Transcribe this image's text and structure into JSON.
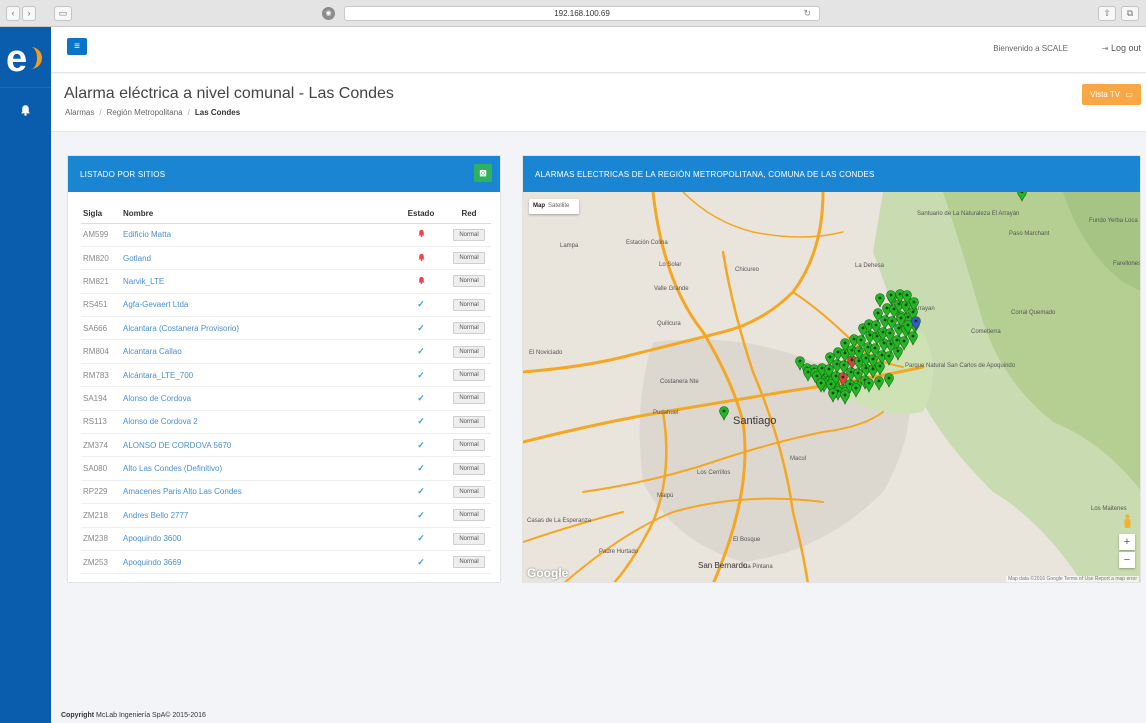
{
  "browser": {
    "url": "192.168.100.69"
  },
  "topbar": {
    "welcome": "Bienvenido a SCALE",
    "logout": "Log out"
  },
  "header": {
    "title": "Alarma eléctrica a nivel comunal - Las Condes",
    "breadcrumb": [
      "Alarmas",
      "Región Metropolitana",
      "Las Condes"
    ],
    "vista_tv": "Vista TV"
  },
  "list": {
    "title": "LISTADO POR SITIOS",
    "columns": [
      "Sigla",
      "Nombre",
      "Estado",
      "Red"
    ],
    "rows": [
      {
        "sigla": "AM599",
        "nombre": "Edificio Matta",
        "estado": "alarm",
        "red": "Normal"
      },
      {
        "sigla": "RM820",
        "nombre": "Gotland",
        "estado": "alarm",
        "red": "Normal"
      },
      {
        "sigla": "RM821",
        "nombre": "Narvik_LTE",
        "estado": "alarm",
        "red": "Normal"
      },
      {
        "sigla": "RS451",
        "nombre": "Agfa-Gevaert Ltda",
        "estado": "ok",
        "red": "Normal"
      },
      {
        "sigla": "SA666",
        "nombre": "Alcantara (Costanera Provisorio)",
        "estado": "ok",
        "red": "Normal"
      },
      {
        "sigla": "RM804",
        "nombre": "Alcantara Callao",
        "estado": "ok",
        "red": "Normal"
      },
      {
        "sigla": "RM783",
        "nombre": "Alcántara_LTE_700",
        "estado": "ok",
        "red": "Normal"
      },
      {
        "sigla": "SA194",
        "nombre": "Alonso de Cordova",
        "estado": "ok",
        "red": "Normal"
      },
      {
        "sigla": "RS113",
        "nombre": "Alonso de Cordova 2",
        "estado": "ok",
        "red": "Normal"
      },
      {
        "sigla": "ZM374",
        "nombre": "ALONSO DE CORDOVA 5670",
        "estado": "ok",
        "red": "Normal"
      },
      {
        "sigla": "SA080",
        "nombre": "Alto Las Condes (Definitivo)",
        "estado": "ok",
        "red": "Normal"
      },
      {
        "sigla": "RP229",
        "nombre": "Amacenes Paris Alto Las Condes",
        "estado": "ok",
        "red": "Normal"
      },
      {
        "sigla": "ZM218",
        "nombre": "Andres Bello 2777",
        "estado": "ok",
        "red": "Normal"
      },
      {
        "sigla": "ZM238",
        "nombre": "Apoquindo 3600",
        "estado": "ok",
        "red": "Normal"
      },
      {
        "sigla": "ZM253",
        "nombre": "Apoquindo 3669",
        "estado": "ok",
        "red": "Normal"
      }
    ]
  },
  "map": {
    "title": "ALARMAS ELECTRICAS DE LA REGIÓN METROPOLITANA, COMUNA DE LAS CONDES",
    "type_map": "Map",
    "type_satellite": "Satellite",
    "footer": "Map data ©2016 Google   Terms of Use   Report a map error",
    "google": "Google",
    "zoom_in": "+",
    "zoom_out": "−",
    "labels": [
      "Lo Solar",
      "Chicureo",
      "Lampa",
      "Estación Colina",
      "La Dehesa",
      "Valle Grande",
      "El Arrayan",
      "Quilicura",
      "El Noviciado",
      "Corral Quemado",
      "Cometierra",
      "Pudahuel",
      "Santiago",
      "Los Cerrillos",
      "Macul",
      "Maipú",
      "Casas de La Esperanza",
      "El Bosque",
      "Padre Hurtado",
      "San Bernardo",
      "La Pintana",
      "Paso Marchant",
      "Fundo Yerba Loca",
      "Farellones",
      "Los Maitenes",
      "Santuario de La Naturaleza El Arrayán",
      "Parque Natural San Carlos de Apoquindo",
      "Costanera Nte"
    ],
    "colors": {
      "ok_marker": "#23b723",
      "alarm_marker": "#e04040",
      "highlight_marker": "#3b55d6",
      "road": "#f5a623"
    }
  },
  "footer": {
    "brand": "Copyright",
    "text": "McLab Ingeniería SpA© 2015-2016"
  }
}
